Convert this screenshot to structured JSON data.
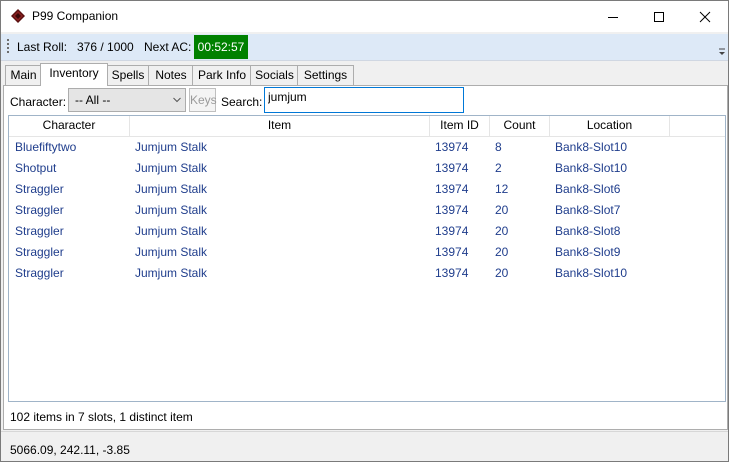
{
  "window": {
    "title": "P99 Companion"
  },
  "status_strip": {
    "last_roll_label": "Last Roll:",
    "last_roll_value": "376 / 1000",
    "next_ac_label": "Next AC:",
    "next_ac_timer": "00:52:57",
    "timer_color": "#008000"
  },
  "tabs": [
    {
      "label": "Main"
    },
    {
      "label": "Inventory",
      "active": true
    },
    {
      "label": "Spells"
    },
    {
      "label": "Notes"
    },
    {
      "label": "Park Info"
    },
    {
      "label": "Socials"
    },
    {
      "label": "Settings"
    }
  ],
  "filters": {
    "character_label": "Character:",
    "character_selected": "-- All --",
    "keys_label": "Keys",
    "search_label": "Search:",
    "search_value": "jumjum"
  },
  "table": {
    "columns": [
      "Character",
      "Item",
      "Item ID",
      "Count",
      "Location"
    ],
    "rows": [
      [
        "Bluefiftytwo",
        "Jumjum Stalk",
        "13974",
        "8",
        "Bank8-Slot10"
      ],
      [
        "Shotput",
        "Jumjum Stalk",
        "13974",
        "2",
        "Bank8-Slot10"
      ],
      [
        "Straggler",
        "Jumjum Stalk",
        "13974",
        "12",
        "Bank8-Slot6"
      ],
      [
        "Straggler",
        "Jumjum Stalk",
        "13974",
        "20",
        "Bank8-Slot7"
      ],
      [
        "Straggler",
        "Jumjum Stalk",
        "13974",
        "20",
        "Bank8-Slot8"
      ],
      [
        "Straggler",
        "Jumjum Stalk",
        "13974",
        "20",
        "Bank8-Slot9"
      ],
      [
        "Straggler",
        "Jumjum Stalk",
        "13974",
        "20",
        "Bank8-Slot10"
      ]
    ],
    "text_color": "#1f3d8c"
  },
  "summary": "102 items in 7 slots, 1 distinct item",
  "coordinates": "5066.09, 242.11, -3.85"
}
